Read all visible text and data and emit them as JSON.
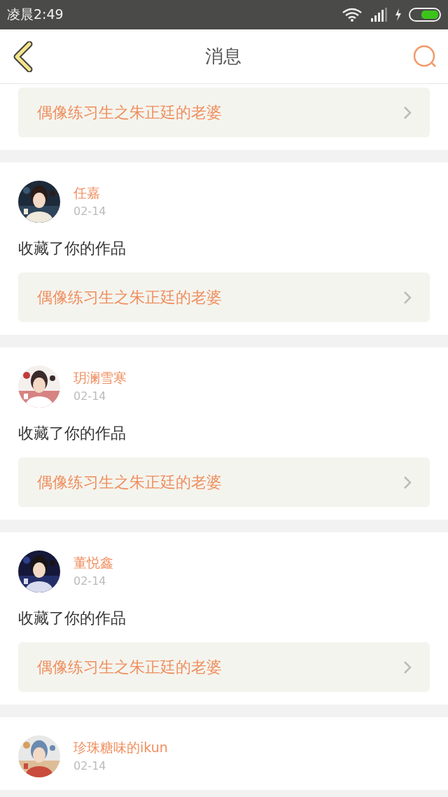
{
  "status_bar": {
    "time": "凌晨2:49"
  },
  "header": {
    "title": "消息"
  },
  "messages": [
    {
      "work": "偶像练习生之朱正廷的老婆"
    },
    {
      "name": "任嘉",
      "date": "02-14",
      "action": "收藏了你的作品",
      "work": "偶像练习生之朱正廷的老婆"
    },
    {
      "name": "玥澜雪寒",
      "date": "02-14",
      "action": "收藏了你的作品",
      "work": "偶像练习生之朱正廷的老婆"
    },
    {
      "name": "董悦鑫",
      "date": "02-14",
      "action": "收藏了你的作品",
      "work": "偶像练习生之朱正廷的老婆"
    },
    {
      "name": "珍珠糖味的ikun",
      "date": "02-14"
    }
  ]
}
